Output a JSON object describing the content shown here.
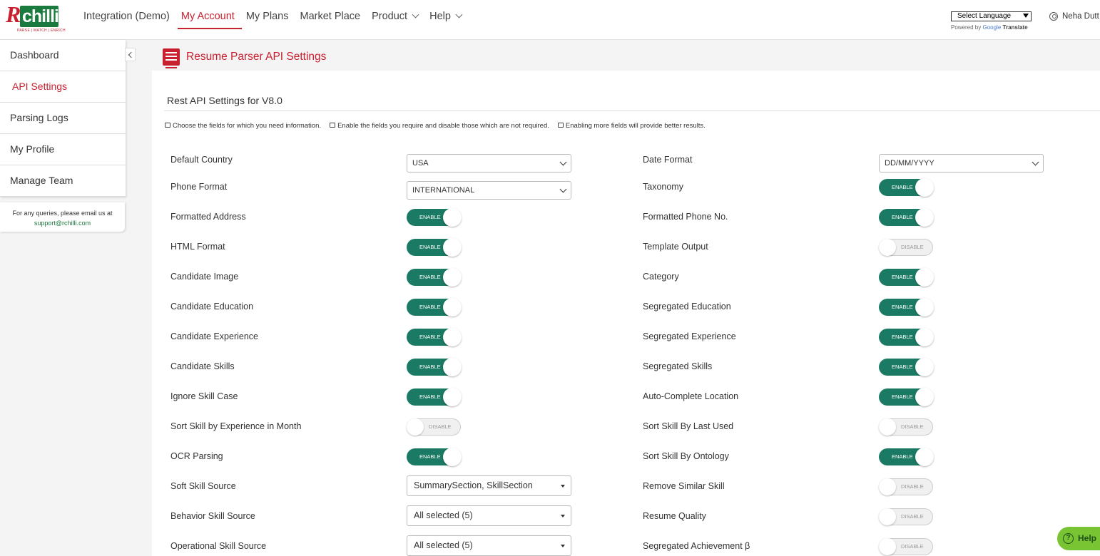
{
  "logo": {
    "brand": "R",
    "chip": "chilli",
    "tagline": "PARSE | MATCH | ENRICH"
  },
  "nav": [
    {
      "label": "Integration (Demo)",
      "active": false,
      "dropdown": false
    },
    {
      "label": "My Account",
      "active": true,
      "dropdown": false
    },
    {
      "label": "My Plans",
      "active": false,
      "dropdown": false
    },
    {
      "label": "Market Place",
      "active": false,
      "dropdown": false
    },
    {
      "label": "Product",
      "active": false,
      "dropdown": true
    },
    {
      "label": "Help",
      "active": false,
      "dropdown": true
    }
  ],
  "language": {
    "selected": "Select Language",
    "powered_prefix": "Powered by",
    "google": "Google",
    "translate": "Translate"
  },
  "user": {
    "name": "Neha Dutt"
  },
  "sidebar": {
    "items": [
      {
        "label": "Dashboard",
        "active": false
      },
      {
        "label": "API Settings",
        "active": true
      },
      {
        "label": "Parsing Logs",
        "active": false
      },
      {
        "label": "My Profile",
        "active": false
      },
      {
        "label": "Manage Team",
        "active": false
      }
    ],
    "query_text": "For any queries, please email us at",
    "query_email": "support@rchilli.com"
  },
  "page": {
    "title": "Resume Parser API Settings",
    "section_title": "Rest API Settings for V8.0",
    "tips": [
      "Choose the fields for which you need information.",
      "Enable the fields you require and disable those which are not required.",
      "Enabling more fields will provide better results."
    ]
  },
  "toggle_labels": {
    "on": "ENABLE",
    "off": "DISABLE"
  },
  "settings_left": [
    {
      "label": "Default Country",
      "control": "select",
      "value": "USA"
    },
    {
      "label": "Phone Format",
      "control": "select",
      "value": "INTERNATIONAL"
    },
    {
      "label": "Formatted Address",
      "control": "toggle",
      "enabled": true
    },
    {
      "label": "HTML Format",
      "control": "toggle",
      "enabled": true
    },
    {
      "label": "Candidate Image",
      "control": "toggle",
      "enabled": true
    },
    {
      "label": "Candidate Education",
      "control": "toggle",
      "enabled": true
    },
    {
      "label": "Candidate Experience",
      "control": "toggle",
      "enabled": true
    },
    {
      "label": "Candidate Skills",
      "control": "toggle",
      "enabled": true
    },
    {
      "label": "Ignore Skill Case",
      "control": "toggle",
      "enabled": true
    },
    {
      "label": "Sort Skill by Experience in Month",
      "control": "toggle",
      "enabled": false
    },
    {
      "label": "OCR Parsing",
      "control": "toggle",
      "enabled": true
    },
    {
      "label": "Soft Skill Source",
      "control": "multi",
      "value": "SummarySection, SkillSection"
    },
    {
      "label": "Behavior Skill Source",
      "control": "multi",
      "value": "All selected (5)"
    },
    {
      "label": "Operational Skill Source",
      "control": "multi",
      "value": "All selected (5)"
    }
  ],
  "settings_right": [
    {
      "label": "Date Format",
      "control": "select",
      "value": "DD/MM/YYYY"
    },
    {
      "label": "Taxonomy",
      "control": "toggle",
      "enabled": true
    },
    {
      "label": "Formatted Phone No.",
      "control": "toggle",
      "enabled": true
    },
    {
      "label": "Template Output",
      "control": "toggle",
      "enabled": false
    },
    {
      "label": "Category",
      "control": "toggle",
      "enabled": true
    },
    {
      "label": "Segregated Education",
      "control": "toggle",
      "enabled": true
    },
    {
      "label": "Segregated Experience",
      "control": "toggle",
      "enabled": true
    },
    {
      "label": "Segregated Skills",
      "control": "toggle",
      "enabled": true
    },
    {
      "label": "Auto-Complete Location",
      "control": "toggle",
      "enabled": true
    },
    {
      "label": "Sort Skill By Last Used",
      "control": "toggle",
      "enabled": false
    },
    {
      "label": "Sort Skill By Ontology",
      "control": "toggle",
      "enabled": true
    },
    {
      "label": "Remove Similar Skill",
      "control": "toggle",
      "enabled": false
    },
    {
      "label": "Resume Quality",
      "control": "toggle",
      "enabled": false
    },
    {
      "label": "Segregated Achievement β",
      "control": "toggle",
      "enabled": false
    }
  ],
  "help_button": {
    "label": "Help"
  },
  "colors": {
    "accent": "#c8202f",
    "enable": "#1b7a63",
    "help": "#79c433"
  }
}
